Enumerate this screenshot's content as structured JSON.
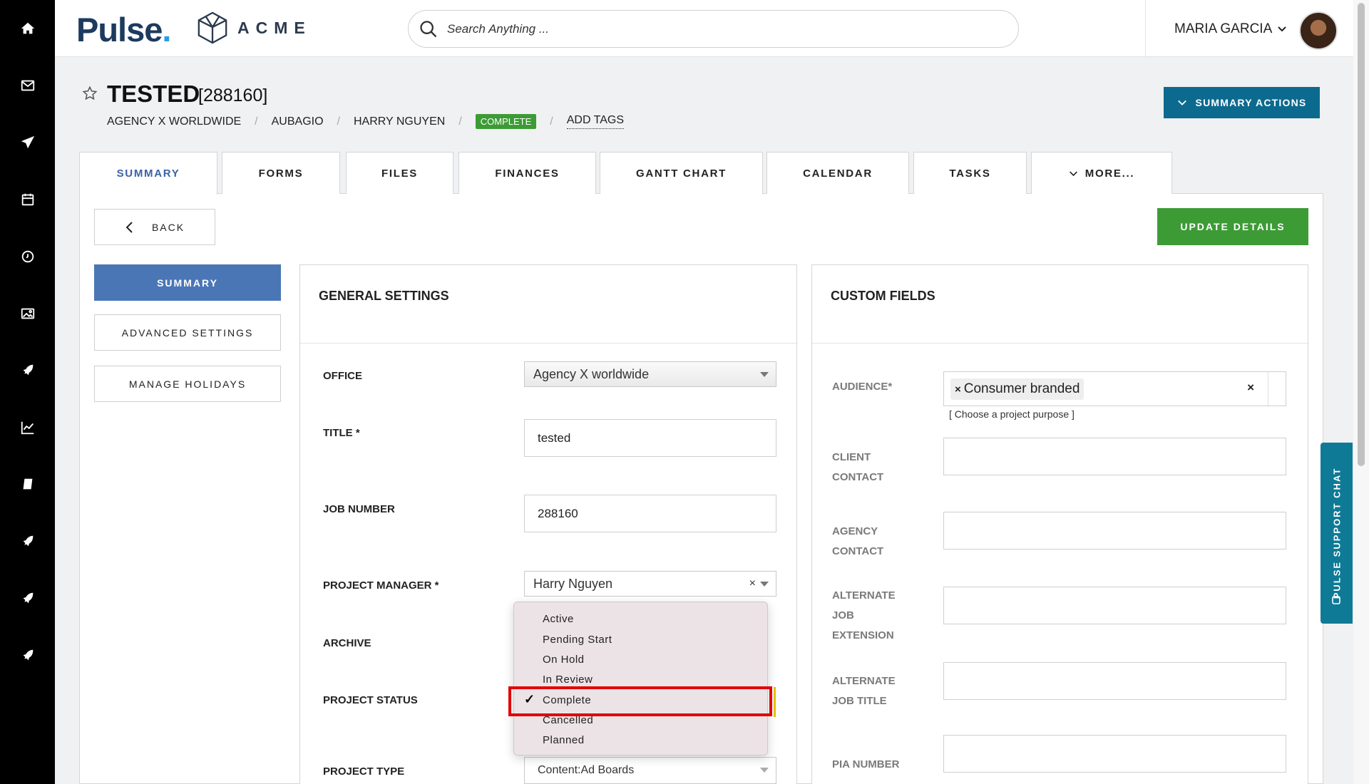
{
  "topbar": {
    "brand": "Pulse",
    "brand_dot": ".",
    "client_logo": "ACME",
    "search_placeholder": "Search Anything ...",
    "user_name": "MARIA GARCIA"
  },
  "rail": {
    "icons": [
      "home-icon",
      "mail-icon",
      "send-icon",
      "calendar-icon",
      "clock-icon",
      "image-icon",
      "rocket-icon",
      "chart-icon",
      "book-icon",
      "rocket-icon",
      "rocket-icon",
      "rocket-icon"
    ]
  },
  "header": {
    "title": "TESTED",
    "job_id": "[288160]",
    "breadcrumb": [
      "AGENCY X WORLDWIDE",
      "AUBAGIO",
      "HARRY NGUYEN"
    ],
    "status_badge": "COMPLETE",
    "add_tags": "ADD TAGS",
    "summary_actions": "SUMMARY ACTIONS"
  },
  "tabs": [
    "SUMMARY",
    "FORMS",
    "FILES",
    "FINANCES",
    "GANTT CHART",
    "CALENDAR",
    "TASKS",
    "MORE..."
  ],
  "actions": {
    "back": "BACK",
    "update": "UPDATE DETAILS"
  },
  "side_nav": [
    "SUMMARY",
    "ADVANCED SETTINGS",
    "MANAGE HOLIDAYS"
  ],
  "general": {
    "heading": "GENERAL SETTINGS",
    "office_label": "OFFICE",
    "office_value": "Agency X worldwide",
    "title_label": "TITLE *",
    "title_value": "tested",
    "job_label": "JOB NUMBER",
    "job_value": "288160",
    "pm_label": "PROJECT MANAGER *",
    "pm_value": "Harry Nguyen",
    "archive_label": "ARCHIVE",
    "status_label": "PROJECT STATUS",
    "type_label": "PROJECT TYPE",
    "type_value": "Content:Ad Boards"
  },
  "status_dropdown": {
    "options": [
      "Active",
      "Pending Start",
      "On Hold",
      "In Review",
      "Complete",
      "Cancelled",
      "Planned"
    ],
    "selected": "Complete",
    "check": "✓"
  },
  "custom": {
    "heading": "CUSTOM FIELDS",
    "audience_label": "AUDIENCE*",
    "audience_tag": "Consumer branded",
    "audience_hint": "[ Choose a project purpose ]",
    "client_contact": [
      "CLIENT",
      "CONTACT"
    ],
    "agency_contact": [
      "AGENCY",
      "CONTACT"
    ],
    "alt_job_ext": [
      "ALTERNATE",
      "JOB",
      "EXTENSION"
    ],
    "alt_job_title": [
      "ALTERNATE",
      "JOB TITLE"
    ],
    "pia_number": "PIA NUMBER"
  },
  "support_chat": "PULSE SUPPORT CHAT",
  "colors": {
    "rail": "#000000",
    "primary_blue": "#4a76b6",
    "teal": "#0d6a8f",
    "green": "#3c9b35",
    "highlight_red": "#e00000"
  }
}
